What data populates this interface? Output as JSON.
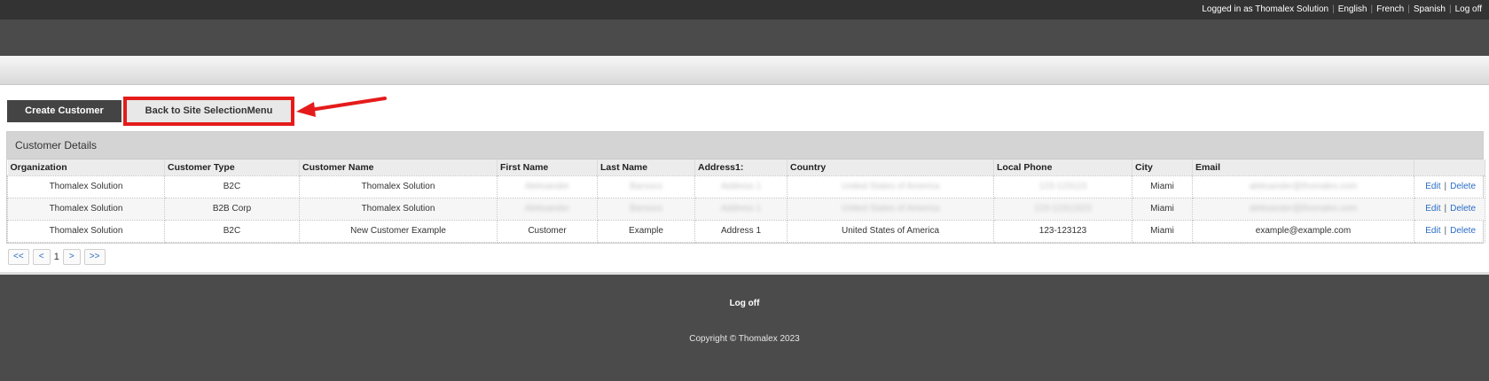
{
  "topbar": {
    "logged_in_text": "Logged in as Thomalex Solution",
    "languages": [
      "English",
      "French",
      "Spanish"
    ],
    "logoff_label": "Log off"
  },
  "buttons": {
    "create_customer": "Create Customer",
    "back_to_site": "Back to Site SelectionMenu"
  },
  "highlight_color": "#e51b1b",
  "panel": {
    "title": "Customer Details"
  },
  "table": {
    "columns": [
      "Organization",
      "Customer Type",
      "Customer Name",
      "First Name",
      "Last Name",
      "Address1:",
      "Country",
      "Local Phone",
      "City",
      "Email",
      ""
    ],
    "rows": [
      {
        "organization": "Thomalex Solution",
        "customer_type": "B2C",
        "customer_name": "Thomalex Solution",
        "first_name": "Aleksander",
        "last_name": "Barsoco",
        "address1": "Address 1",
        "country": "United States of America",
        "local_phone": "123-123123",
        "city": "Miami",
        "email": "aleksander@thomalex.com"
      },
      {
        "organization": "Thomalex Solution",
        "customer_type": "B2B Corp",
        "customer_name": "Thomalex Solution",
        "first_name": "Aleksander",
        "last_name": "Barsoco",
        "address1": "Address 1",
        "country": "United States of America",
        "local_phone": "123-12312323",
        "city": "Miami",
        "email": "aleksander@thomalex.com"
      },
      {
        "organization": "Thomalex Solution",
        "customer_type": "B2C",
        "customer_name": "New Customer Example",
        "first_name": "Customer",
        "last_name": "Example",
        "address1": "Address 1",
        "country": "United States of America",
        "local_phone": "123-123123",
        "city": "Miami",
        "email": "example@example.com"
      }
    ],
    "edit_label": "Edit",
    "delete_label": "Delete"
  },
  "pager": {
    "first": "<<",
    "prev": "<",
    "current": "1",
    "next": ">",
    "last": ">>"
  },
  "footer": {
    "logoff_label": "Log off",
    "copyright": "Copyright © Thomalex 2023"
  }
}
